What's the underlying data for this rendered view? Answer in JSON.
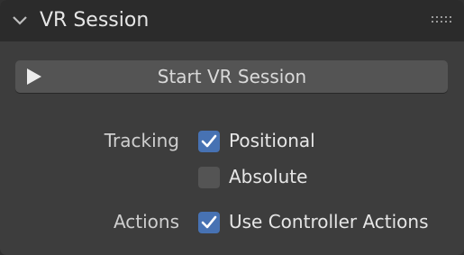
{
  "panel": {
    "title": "VR Session",
    "collapse_icon": "chevron-down-icon",
    "drag_icon": "drag-handle-icon"
  },
  "start_button": {
    "label": "Start VR Session",
    "icon": "play-icon"
  },
  "tracking": {
    "label": "Tracking",
    "options": [
      {
        "label": "Positional",
        "checked": true
      },
      {
        "label": "Absolute",
        "checked": false
      }
    ]
  },
  "actions": {
    "label": "Actions",
    "options": [
      {
        "label": "Use Controller Actions",
        "checked": true
      }
    ]
  },
  "colors": {
    "panel_bg": "#3d3d3d",
    "header_bg": "#2b2b2b",
    "button_bg": "#545454",
    "checkbox_checked": "#4772b3",
    "checkbox_unchecked": "#545454"
  }
}
